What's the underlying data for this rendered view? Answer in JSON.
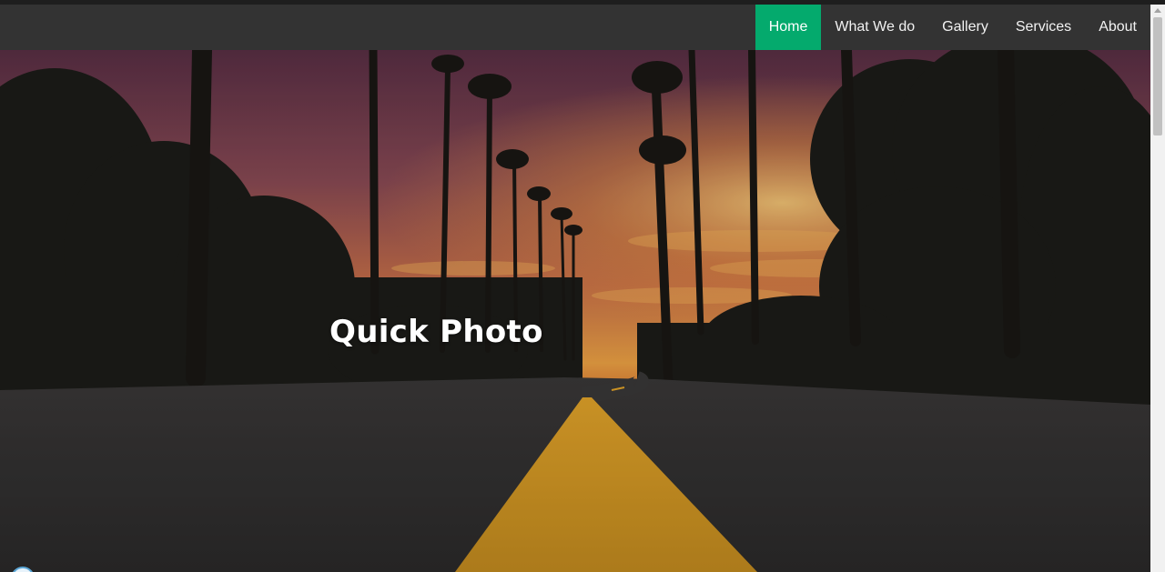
{
  "nav": {
    "items": [
      {
        "label": "Home",
        "active": true
      },
      {
        "label": "What We do",
        "active": false
      },
      {
        "label": "Gallery",
        "active": false
      },
      {
        "label": "Services",
        "active": false
      },
      {
        "label": "About",
        "active": false
      }
    ],
    "active_color": "#04aa6d",
    "bar_color": "#333333"
  },
  "hero": {
    "title": "Quick Photo",
    "background": "sunset-road-palm-trees-photo"
  }
}
